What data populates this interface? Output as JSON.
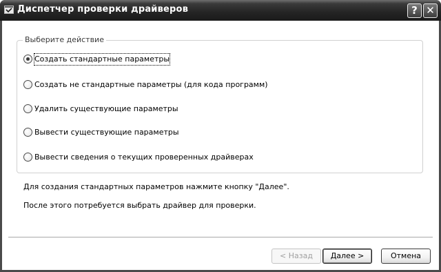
{
  "window": {
    "title": "Диспетчер проверки драйверов",
    "help_button": "?",
    "close_button": "✕"
  },
  "group": {
    "legend": "Выберите действие",
    "options": [
      {
        "label": "Создать стандартные параметры",
        "selected": true
      },
      {
        "label": "Создать не стандартные параметры (для кода программ)",
        "selected": false
      },
      {
        "label": "Удалить существующие параметры",
        "selected": false
      },
      {
        "label": "Вывести существующие параметры",
        "selected": false
      },
      {
        "label": "Вывести сведения о текущих проверенных драйверах",
        "selected": false
      }
    ]
  },
  "info": {
    "line1": "Для создания стандартных параметров нажмите кнопку \"Далее\".",
    "line2": "После этого потребуется выбрать драйвер для проверки."
  },
  "buttons": {
    "back": "< Назад",
    "next": "Далее >",
    "cancel": "Отмена"
  },
  "icons": {
    "title_icon": "window-checkmark-icon",
    "help": "help-icon",
    "close": "close-icon"
  }
}
